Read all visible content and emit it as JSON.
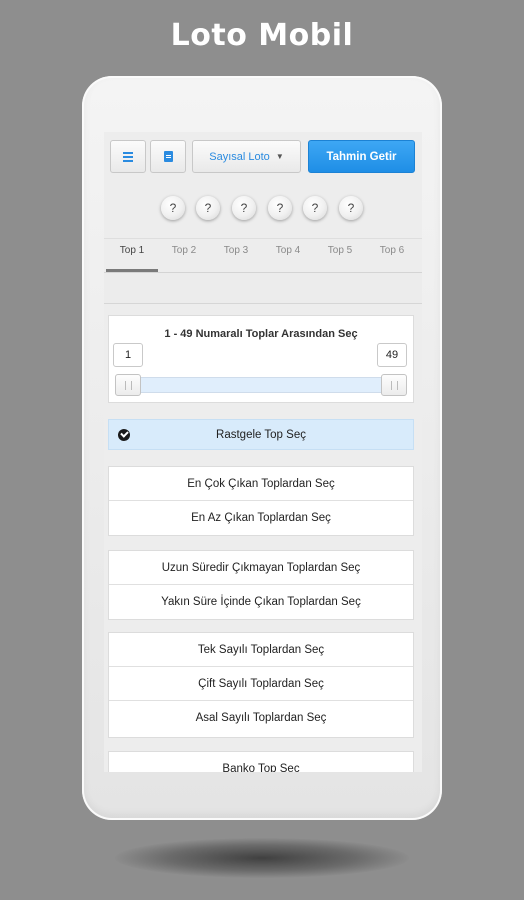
{
  "promo_title": "Loto Mobil",
  "toolbar": {
    "game_select": "Sayısal Loto",
    "predict_button": "Tahmin Getir"
  },
  "balls": [
    "?",
    "?",
    "?",
    "?",
    "?",
    "?"
  ],
  "tabs": [
    "Top 1",
    "Top 2",
    "Top 3",
    "Top 4",
    "Top 5",
    "Top 6"
  ],
  "active_tab": "Top 1",
  "range": {
    "title": "1 - 49 Numaralı Toplar Arasından Seç",
    "min": "1",
    "max": "49"
  },
  "random_option": "Rastgele Top Seç",
  "groups": [
    [
      "En Çok Çıkan Toplardan Seç",
      "En Az Çıkan Toplardan Seç"
    ],
    [
      "Uzun Süredir Çıkmayan Toplardan Seç",
      "Yakın Süre İçinde Çıkan Toplardan Seç"
    ],
    [
      "Tek Sayılı Toplardan Seç",
      "Çift Sayılı Toplardan Seç",
      "Asal Sayılı Toplardan Seç"
    ],
    [
      "Banko Top Seç"
    ]
  ],
  "colors": {
    "background": "#8e8e8e",
    "accent": "#1f8ee6",
    "selected_row": "#d8ebfb",
    "slider_track": "#e0eefc"
  },
  "icons": {
    "menu": "hamburger-icon",
    "doc": "document-icon",
    "dropdown": "chevron-down-icon",
    "selected": "check-circle-icon"
  }
}
